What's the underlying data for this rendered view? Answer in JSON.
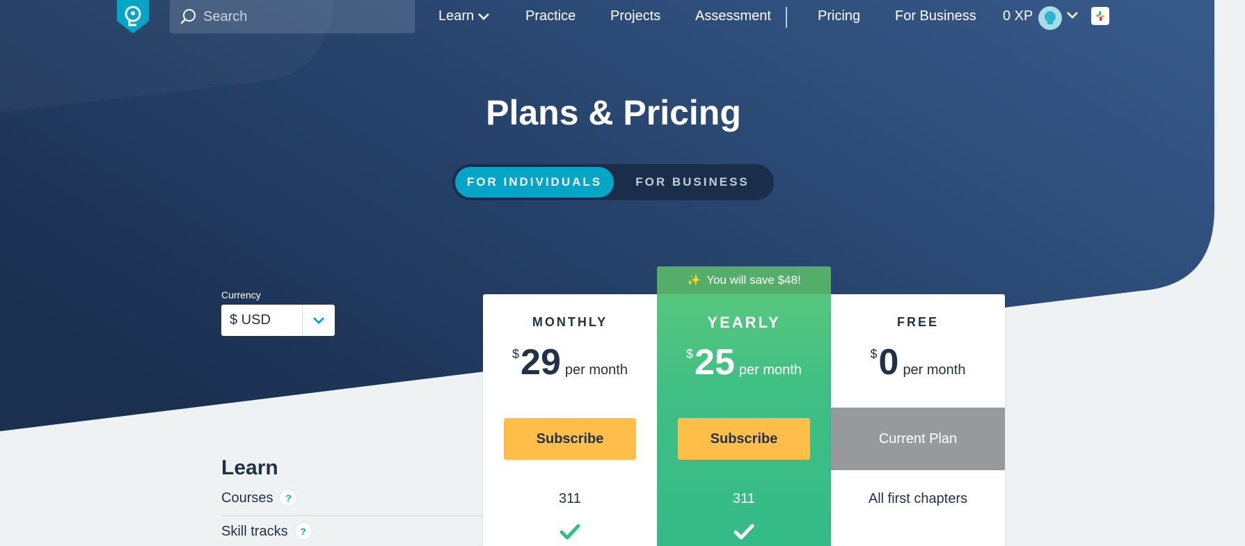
{
  "nav": {
    "search_placeholder": "Search",
    "links": [
      {
        "label": "Learn"
      },
      {
        "label": "Practice"
      },
      {
        "label": "Projects"
      },
      {
        "label": "Assessment"
      },
      {
        "label": "Pricing"
      },
      {
        "label": "For Business"
      }
    ],
    "xp": "0 XP"
  },
  "hero": {
    "title": "Plans & Pricing",
    "toggle": {
      "individuals": "FOR INDIVIDUALS",
      "business": "FOR BUSINESS",
      "active": "individuals"
    }
  },
  "currency": {
    "label": "Currency",
    "value": "$ USD"
  },
  "plans": [
    {
      "name": "MONTHLY",
      "currency_symbol": "$",
      "amount": "29",
      "period": "per month",
      "button": "Subscribe",
      "courses": "311",
      "skill_tracks": true
    },
    {
      "name": "YEARLY",
      "banner": "You will save $48!",
      "currency_symbol": "$",
      "amount": "25",
      "period": "per month",
      "button": "Subscribe",
      "courses": "311",
      "skill_tracks": true
    },
    {
      "name": "FREE",
      "currency_symbol": "$",
      "amount": "0",
      "period": "per month",
      "button": "Current Plan",
      "courses": "All first chapters",
      "skill_tracks": false
    }
  ],
  "features": {
    "section": "Learn",
    "rows": [
      {
        "label": "Courses",
        "help": "?"
      },
      {
        "label": "Skill tracks",
        "help": "?"
      }
    ]
  },
  "colors": {
    "hero_dark": "#1d3254",
    "hero_light": "#355a8a",
    "accent": "#05a5c7",
    "yearly_green": "#3fbf85",
    "subscribe_yellow": "#ffbd4a",
    "current_plan_gray": "#979a9c"
  },
  "icons": [
    "brain-logo-icon",
    "search-icon",
    "chevron-down-icon",
    "avatar-icon",
    "slack-icon",
    "sparkle-icon",
    "checkmark-icon",
    "question-icon"
  ]
}
